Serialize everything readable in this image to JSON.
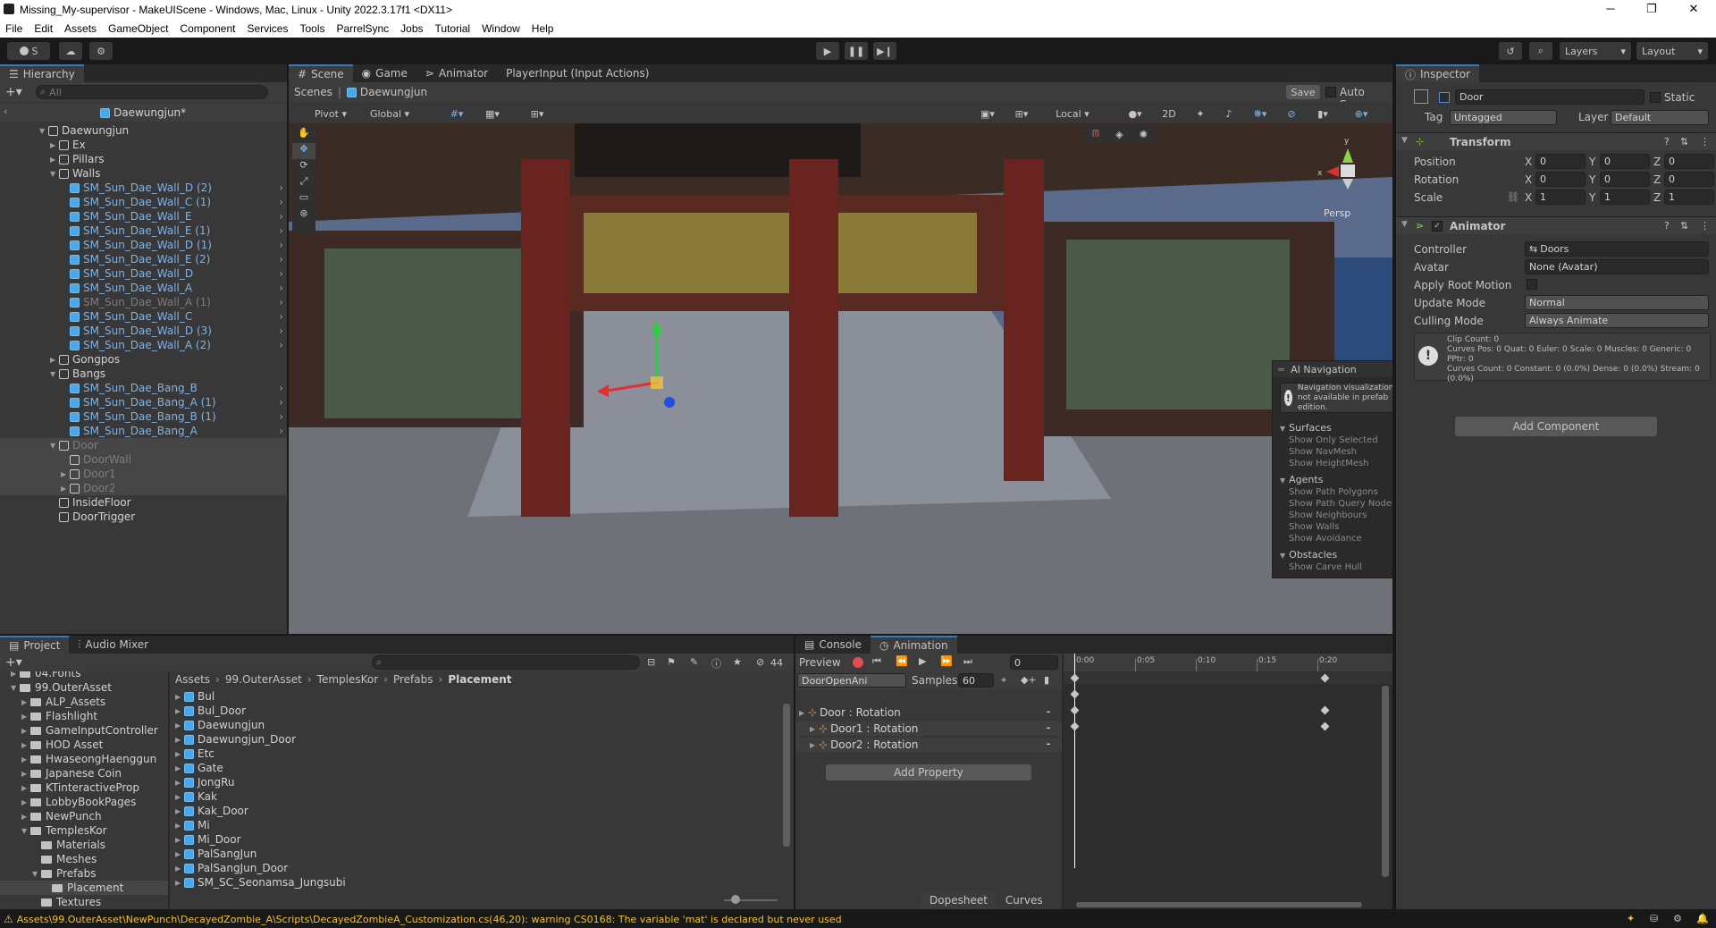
{
  "window": {
    "title": "Missing_My-supervisor - MakeUIScene - Windows, Mac, Linux - Unity 2022.3.17f1 <DX11>",
    "minimize": "─",
    "maximize": "❐",
    "close": "✕"
  },
  "menu": [
    "File",
    "Edit",
    "Assets",
    "GameObject",
    "Component",
    "Services",
    "Tools",
    "ParrelSync",
    "Jobs",
    "Tutorial",
    "Window",
    "Help"
  ],
  "toolbar": {
    "account": "S",
    "layers": "Layers",
    "layout": "Layout"
  },
  "hierarchy": {
    "tab": "Hierarchy",
    "search_placeholder": "All",
    "scene": "Daewungjun*",
    "rows": [
      {
        "label": "Daewungjun",
        "indent": 0,
        "fold": "▼",
        "style": "normal",
        "blue": false
      },
      {
        "label": "Ex",
        "indent": 1,
        "fold": "▶",
        "style": "normal",
        "blue": false
      },
      {
        "label": "Pillars",
        "indent": 1,
        "fold": "▶",
        "style": "normal",
        "blue": false
      },
      {
        "label": "Walls",
        "indent": 1,
        "fold": "▼",
        "style": "normal",
        "blue": false
      },
      {
        "label": "SM_Sun_Dae_Wall_D (2)",
        "indent": 2,
        "fold": "",
        "style": "sel",
        "blue": true
      },
      {
        "label": "SM_Sun_Dae_Wall_C (1)",
        "indent": 2,
        "fold": "",
        "style": "sel",
        "blue": true
      },
      {
        "label": "SM_Sun_Dae_Wall_E",
        "indent": 2,
        "fold": "",
        "style": "sel",
        "blue": true
      },
      {
        "label": "SM_Sun_Dae_Wall_E (1)",
        "indent": 2,
        "fold": "",
        "style": "sel",
        "blue": true
      },
      {
        "label": "SM_Sun_Dae_Wall_D (1)",
        "indent": 2,
        "fold": "",
        "style": "sel",
        "blue": true
      },
      {
        "label": "SM_Sun_Dae_Wall_E (2)",
        "indent": 2,
        "fold": "",
        "style": "sel",
        "blue": true
      },
      {
        "label": "SM_Sun_Dae_Wall_D",
        "indent": 2,
        "fold": "",
        "style": "sel",
        "blue": true
      },
      {
        "label": "SM_Sun_Dae_Wall_A",
        "indent": 2,
        "fold": "",
        "style": "sel",
        "blue": true
      },
      {
        "label": "SM_Sun_Dae_Wall_A (1)",
        "indent": 2,
        "fold": "",
        "style": "dimsel",
        "blue": true
      },
      {
        "label": "SM_Sun_Dae_Wall_C",
        "indent": 2,
        "fold": "",
        "style": "sel",
        "blue": true
      },
      {
        "label": "SM_Sun_Dae_Wall_D (3)",
        "indent": 2,
        "fold": "",
        "style": "sel",
        "blue": true
      },
      {
        "label": "SM_Sun_Dae_Wall_A (2)",
        "indent": 2,
        "fold": "",
        "style": "sel",
        "blue": true
      },
      {
        "label": "Gongpos",
        "indent": 1,
        "fold": "▶",
        "style": "normal",
        "blue": false
      },
      {
        "label": "Bangs",
        "indent": 1,
        "fold": "▼",
        "style": "normal",
        "blue": false
      },
      {
        "label": "SM_Sun_Dae_Bang_B",
        "indent": 2,
        "fold": "",
        "style": "sel",
        "blue": true
      },
      {
        "label": "SM_Sun_Dae_Bang_A (1)",
        "indent": 2,
        "fold": "",
        "style": "sel",
        "blue": true
      },
      {
        "label": "SM_Sun_Dae_Bang_B (1)",
        "indent": 2,
        "fold": "",
        "style": "sel",
        "blue": true
      },
      {
        "label": "SM_Sun_Dae_Bang_A",
        "indent": 2,
        "fold": "",
        "style": "sel",
        "blue": true
      },
      {
        "label": "Door",
        "indent": 1,
        "fold": "▼",
        "style": "dim",
        "blue": false
      },
      {
        "label": "DoorWall",
        "indent": 2,
        "fold": "",
        "style": "dim",
        "blue": false
      },
      {
        "label": "Door1",
        "indent": 2,
        "fold": "▶",
        "style": "dim",
        "blue": false
      },
      {
        "label": "Door2",
        "indent": 2,
        "fold": "▶",
        "style": "dim",
        "blue": false
      },
      {
        "label": "InsideFloor",
        "indent": 1,
        "fold": "",
        "style": "normal",
        "blue": false
      },
      {
        "label": "DoorTrigger",
        "indent": 1,
        "fold": "",
        "style": "normal",
        "blue": false
      }
    ]
  },
  "scene": {
    "tabs": [
      "Scene",
      "Game",
      "Animator",
      "PlayerInput (Input Actions)"
    ],
    "breadcrumb_root": "Scenes",
    "breadcrumb_prefab": "Daewungjun",
    "save": "Save",
    "auto_save": "Auto Save",
    "pivot": "Pivot",
    "global": "Global",
    "local": "Local",
    "mode_2d": "2D",
    "persp": "Persp"
  },
  "ai_navigation": {
    "title": "AI Navigation",
    "notice": "Navigation visualization is not available in prefab edition.",
    "sections": [
      {
        "title": "Surfaces",
        "items": [
          {
            "label": "Show Only Selected",
            "checked": false
          },
          {
            "label": "Show NavMesh",
            "checked": true
          },
          {
            "label": "Show HeightMesh",
            "checked": false
          }
        ]
      },
      {
        "title": "Agents",
        "items": [
          {
            "label": "Show Path Polygons",
            "checked": true
          },
          {
            "label": "Show Path Query Nodes",
            "checked": false
          },
          {
            "label": "Show Neighbours",
            "checked": false
          },
          {
            "label": "Show Walls",
            "checked": false
          },
          {
            "label": "Show Avoidance",
            "checked": false
          }
        ]
      },
      {
        "title": "Obstacles",
        "items": [
          {
            "label": "Show Carve Hull",
            "checked": false
          }
        ]
      }
    ]
  },
  "inspector": {
    "tab": "Inspector",
    "object_name": "Door",
    "static": "Static",
    "tag_label": "Tag",
    "tag_value": "Untagged",
    "layer_label": "Layer",
    "layer_value": "Default",
    "transform": {
      "title": "Transform",
      "rows": [
        {
          "label": "Position",
          "x": "0",
          "y": "0",
          "z": "0"
        },
        {
          "label": "Rotation",
          "x": "0",
          "y": "0",
          "z": "0"
        },
        {
          "label": "Scale",
          "x": "1",
          "y": "1",
          "z": "1"
        }
      ]
    },
    "animator": {
      "title": "Animator",
      "controller_label": "Controller",
      "controller_value": "Doors",
      "avatar_label": "Avatar",
      "avatar_value": "None (Avatar)",
      "root_motion_label": "Apply Root Motion",
      "update_mode_label": "Update Mode",
      "update_mode_value": "Normal",
      "culling_label": "Culling Mode",
      "culling_value": "Always Animate",
      "info": [
        "Clip Count: 0",
        "Curves Pos: 0 Quat: 0 Euler: 0 Scale: 0 Muscles: 0 Generic: 0 PPtr: 0",
        "Curves Count: 0 Constant: 0 (0.0%) Dense: 0 (0.0%) Stream: 0 (0.0%)"
      ]
    },
    "add_component": "Add Component"
  },
  "project": {
    "tabs": [
      "Project",
      "Audio Mixer"
    ],
    "count": "44",
    "breadcrumb": [
      "Assets",
      "99.OuterAsset",
      "TemplesKor",
      "Prefabs",
      "Placement"
    ],
    "folders": [
      {
        "label": "04.Fonts",
        "indent": 1
      },
      {
        "label": "99.OuterAsset",
        "indent": 1
      },
      {
        "label": "ALP_Assets",
        "indent": 2
      },
      {
        "label": "Flashlight",
        "indent": 2
      },
      {
        "label": "GameInputController",
        "indent": 2
      },
      {
        "label": "HOD Asset",
        "indent": 2
      },
      {
        "label": "HwaseongHaenggun",
        "indent": 2
      },
      {
        "label": "Japanese Coin",
        "indent": 2
      },
      {
        "label": "KTinteractiveProp",
        "indent": 2
      },
      {
        "label": "LobbyBookPages",
        "indent": 2
      },
      {
        "label": "NewPunch",
        "indent": 2
      },
      {
        "label": "TemplesKor",
        "indent": 2
      },
      {
        "label": "Materials",
        "indent": 3
      },
      {
        "label": "Meshes",
        "indent": 3
      },
      {
        "label": "Prefabs",
        "indent": 3
      },
      {
        "label": "Placement",
        "indent": 4
      },
      {
        "label": "Textures",
        "indent": 3
      }
    ],
    "assets": [
      "Bul",
      "Bul_Door",
      "Daewungjun",
      "Daewungjun_Door",
      "Etc",
      "Gate",
      "JongRu",
      "Kak",
      "Kak_Door",
      "Mi",
      "Mi_Door",
      "PalSangJun",
      "PalSangJun_Door",
      "SM_SC_Seonamsa_Jungsubi"
    ]
  },
  "animation": {
    "tabs": [
      "Console",
      "Animation"
    ],
    "preview": "Preview",
    "frame": "0",
    "clip": "DoorOpenAni",
    "samples_label": "Samples",
    "samples_value": "60",
    "properties": [
      "Door : Rotation",
      "Door1 : Rotation",
      "Door2 : Rotation"
    ],
    "add_property": "Add Property",
    "ruler": [
      "0:00",
      "0:05",
      "0:10",
      "0:15",
      "0:20"
    ],
    "dopesheet": "Dopesheet",
    "curves": "Curves"
  },
  "status": {
    "message": "Assets\\99.OuterAsset\\NewPunch\\DecayedZombie_A\\Scripts\\DecayedZombieA_Customization.cs(46,20): warning CS0168: The variable 'mat' is declared but never used"
  },
  "colors": {
    "accent": "#3a79bb",
    "selected_text": "#7bb4ee",
    "warning": "#f2c12e"
  }
}
